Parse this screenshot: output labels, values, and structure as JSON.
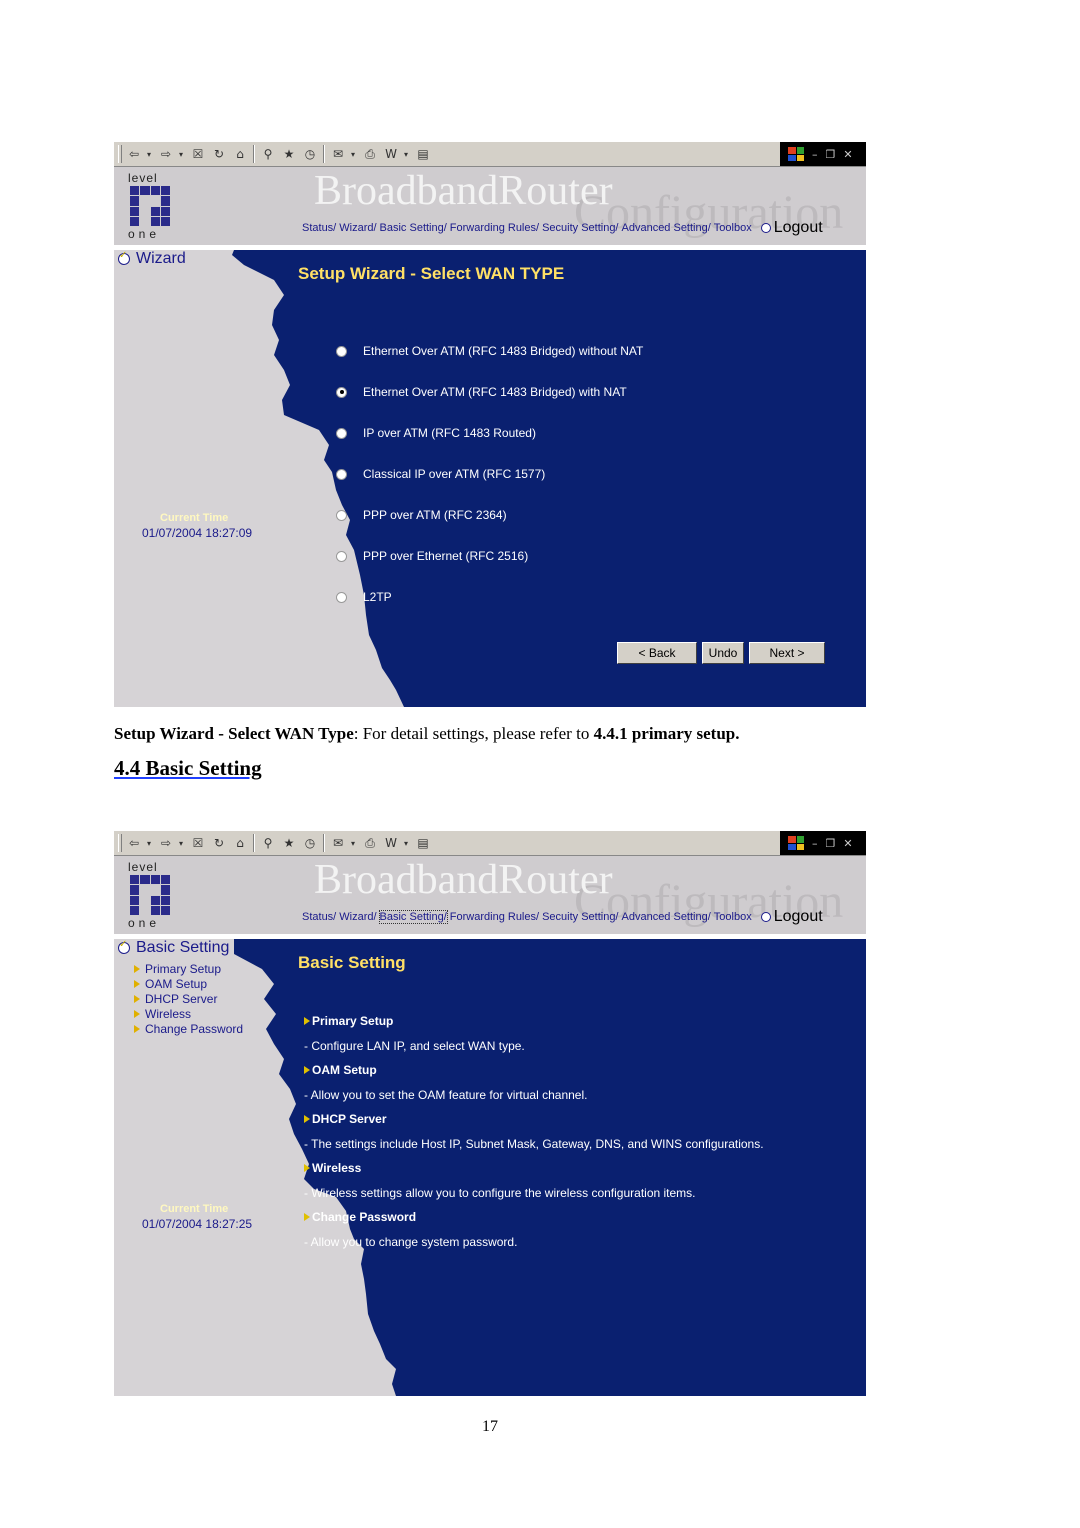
{
  "document": {
    "caption_bold": "Setup Wizard - Select WAN Type",
    "caption_text": ": For detail settings, please refer to ",
    "caption_ref": "4.4.1 primary setup.",
    "section_heading": "4.4 Basic Setting",
    "page_number": "17"
  },
  "browser": {
    "toolbar_icons": [
      "back-icon",
      "forward-icon",
      "stop-icon",
      "refresh-icon",
      "home-icon",
      "search-icon",
      "favorites-icon",
      "history-icon",
      "mail-icon",
      "print-icon",
      "edit-word-icon",
      "discuss-icon"
    ]
  },
  "router": {
    "logo_top": "level",
    "logo_bottom": "one",
    "brand": "BroadbandRouter",
    "brand_sub": "Configuration",
    "nav": [
      "Status/",
      "Wizard/",
      "Basic Setting/",
      "Forwarding Rules/",
      "Secuity Setting/",
      "Advanced Setting/",
      "Toolbox"
    ],
    "logout": "Logout",
    "time_label": "Current Time"
  },
  "screen1": {
    "side_title": "Wizard",
    "title": "Setup Wizard - Select WAN TYPE",
    "time_value": "01/07/2004 18:27:09",
    "options": [
      {
        "label": "Ethernet Over ATM (RFC 1483 Bridged) without NAT",
        "selected": false
      },
      {
        "label": "Ethernet Over ATM (RFC 1483 Bridged) with NAT",
        "selected": true
      },
      {
        "label": "IP over ATM (RFC 1483 Routed)",
        "selected": false
      },
      {
        "label": "Classical IP over ATM (RFC 1577)",
        "selected": false
      },
      {
        "label": "PPP over ATM (RFC 2364)",
        "selected": false
      },
      {
        "label": "PPP over Ethernet (RFC 2516)",
        "selected": false
      },
      {
        "label": "L2TP",
        "selected": false
      }
    ],
    "buttons": {
      "back": "< Back",
      "undo": "Undo",
      "next": "Next >"
    }
  },
  "screen2": {
    "side_title": "Basic Setting",
    "side_items": [
      "Primary Setup",
      "OAM Setup",
      "DHCP Server",
      "Wireless",
      "Change Password"
    ],
    "title": "Basic Setting",
    "time_value": "01/07/2004 18:27:25",
    "sections": [
      {
        "head": "Primary Setup",
        "desc": "-   Configure LAN IP, and select WAN type."
      },
      {
        "head": "OAM Setup",
        "desc": "-   Allow you to set the OAM feature for virtual channel."
      },
      {
        "head": "DHCP Server",
        "desc": "-   The settings include Host IP, Subnet Mask, Gateway, DNS, and WINS configurations."
      },
      {
        "head": "Wireless",
        "desc": "-   Wireless settings allow you to configure the wireless configuration items."
      },
      {
        "head": "Change Password",
        "desc": "-   Allow you to change system password."
      }
    ]
  },
  "colors": {
    "panel_blue": "#0a2070",
    "title_yellow": "#ffe066",
    "side_gray": "#d6d3d6"
  }
}
